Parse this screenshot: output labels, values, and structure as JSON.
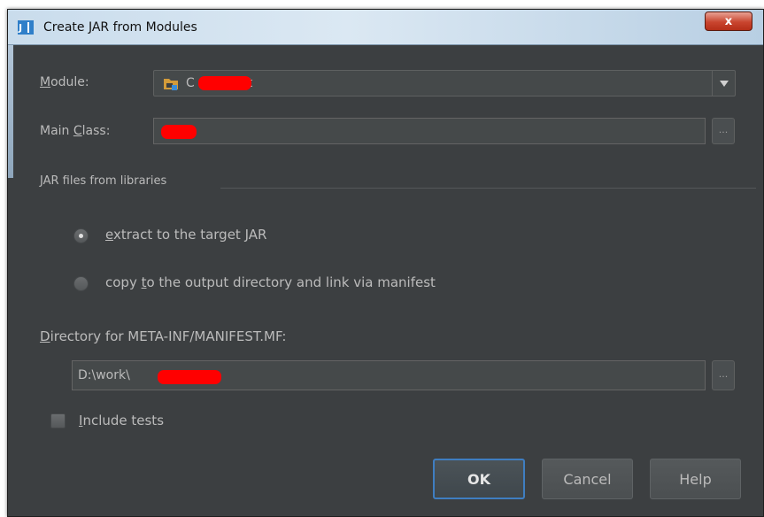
{
  "window": {
    "title": "Create JAR from Modules",
    "close_label": "x",
    "colors": {
      "background": "#3c3f41",
      "accent": "#3f7ec1",
      "text": "#bbbbbb"
    }
  },
  "module": {
    "label_prefix": "",
    "label_mnemonic": "M",
    "label_rest": "odule:",
    "value": "C",
    "value_suffix": "t",
    "icon": "module-folder-icon"
  },
  "main_class": {
    "label_prefix": "Main ",
    "label_mnemonic": "C",
    "label_rest": "lass:",
    "value": "",
    "browse_label": "..."
  },
  "libraries": {
    "section_title": "JAR files from libraries",
    "options": [
      {
        "pre": "",
        "mnemonic": "e",
        "post": "xtract to the target JAR",
        "selected": true
      },
      {
        "pre": "copy ",
        "mnemonic": "t",
        "post": "o the output directory and link via manifest",
        "selected": false
      }
    ]
  },
  "manifest_dir": {
    "label_prefix": "",
    "label_mnemonic": "D",
    "label_rest": "irectory for META-INF/MANIFEST.MF:",
    "value": "D:\\work\\",
    "browse_label": "..."
  },
  "include_tests": {
    "label_mnemonic": "I",
    "label_rest": "nclude tests",
    "checked": false
  },
  "buttons": {
    "ok": "OK",
    "cancel": "Cancel",
    "help": "Help"
  }
}
